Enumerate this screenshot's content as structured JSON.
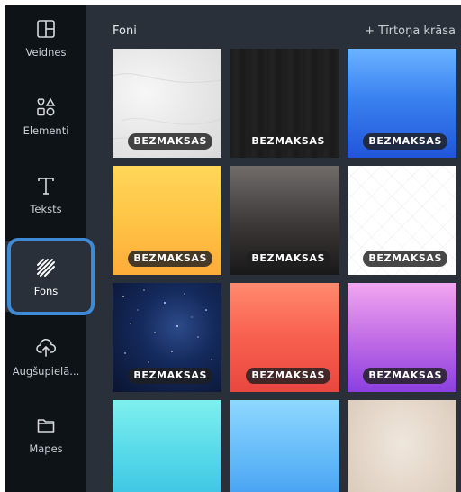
{
  "sidebar": {
    "items": [
      {
        "label": "Veidnes",
        "icon": "templates-icon"
      },
      {
        "label": "Elementi",
        "icon": "elements-icon"
      },
      {
        "label": "Teksts",
        "icon": "text-icon"
      },
      {
        "label": "Fons",
        "icon": "background-icon",
        "active": true
      },
      {
        "label": "Augšupielā...",
        "icon": "upload-icon"
      },
      {
        "label": "Mapes",
        "icon": "folder-icon"
      }
    ]
  },
  "panel": {
    "title": "Foni",
    "color_link": "+ Tīrtoņa krāsa"
  },
  "backgrounds": {
    "badge": "BEZMAKSAS",
    "tiles": [
      {
        "name": "white-marble",
        "badge": "BEZMAKSAS"
      },
      {
        "name": "dark-wood",
        "badge": "BEZMAKSAS"
      },
      {
        "name": "blue-gradient",
        "badge": "BEZMAKSAS"
      },
      {
        "name": "yellow-gradient",
        "badge": "BEZMAKSAS"
      },
      {
        "name": "dark-gray-gradient",
        "badge": "BEZMAKSAS"
      },
      {
        "name": "white-pattern",
        "badge": "BEZMAKSAS"
      },
      {
        "name": "starry-night",
        "badge": "BEZMAKSAS"
      },
      {
        "name": "coral-gradient",
        "badge": "BEZMAKSAS"
      },
      {
        "name": "purple-gradient",
        "badge": "BEZMAKSAS"
      },
      {
        "name": "cyan-gradient",
        "badge": ""
      },
      {
        "name": "sky-blue-gradient",
        "badge": ""
      },
      {
        "name": "beige-texture",
        "badge": ""
      }
    ]
  },
  "colors": {
    "sidebar_bg": "#0e1318",
    "panel_bg": "#293039",
    "focus_ring": "#3d8ad6"
  }
}
